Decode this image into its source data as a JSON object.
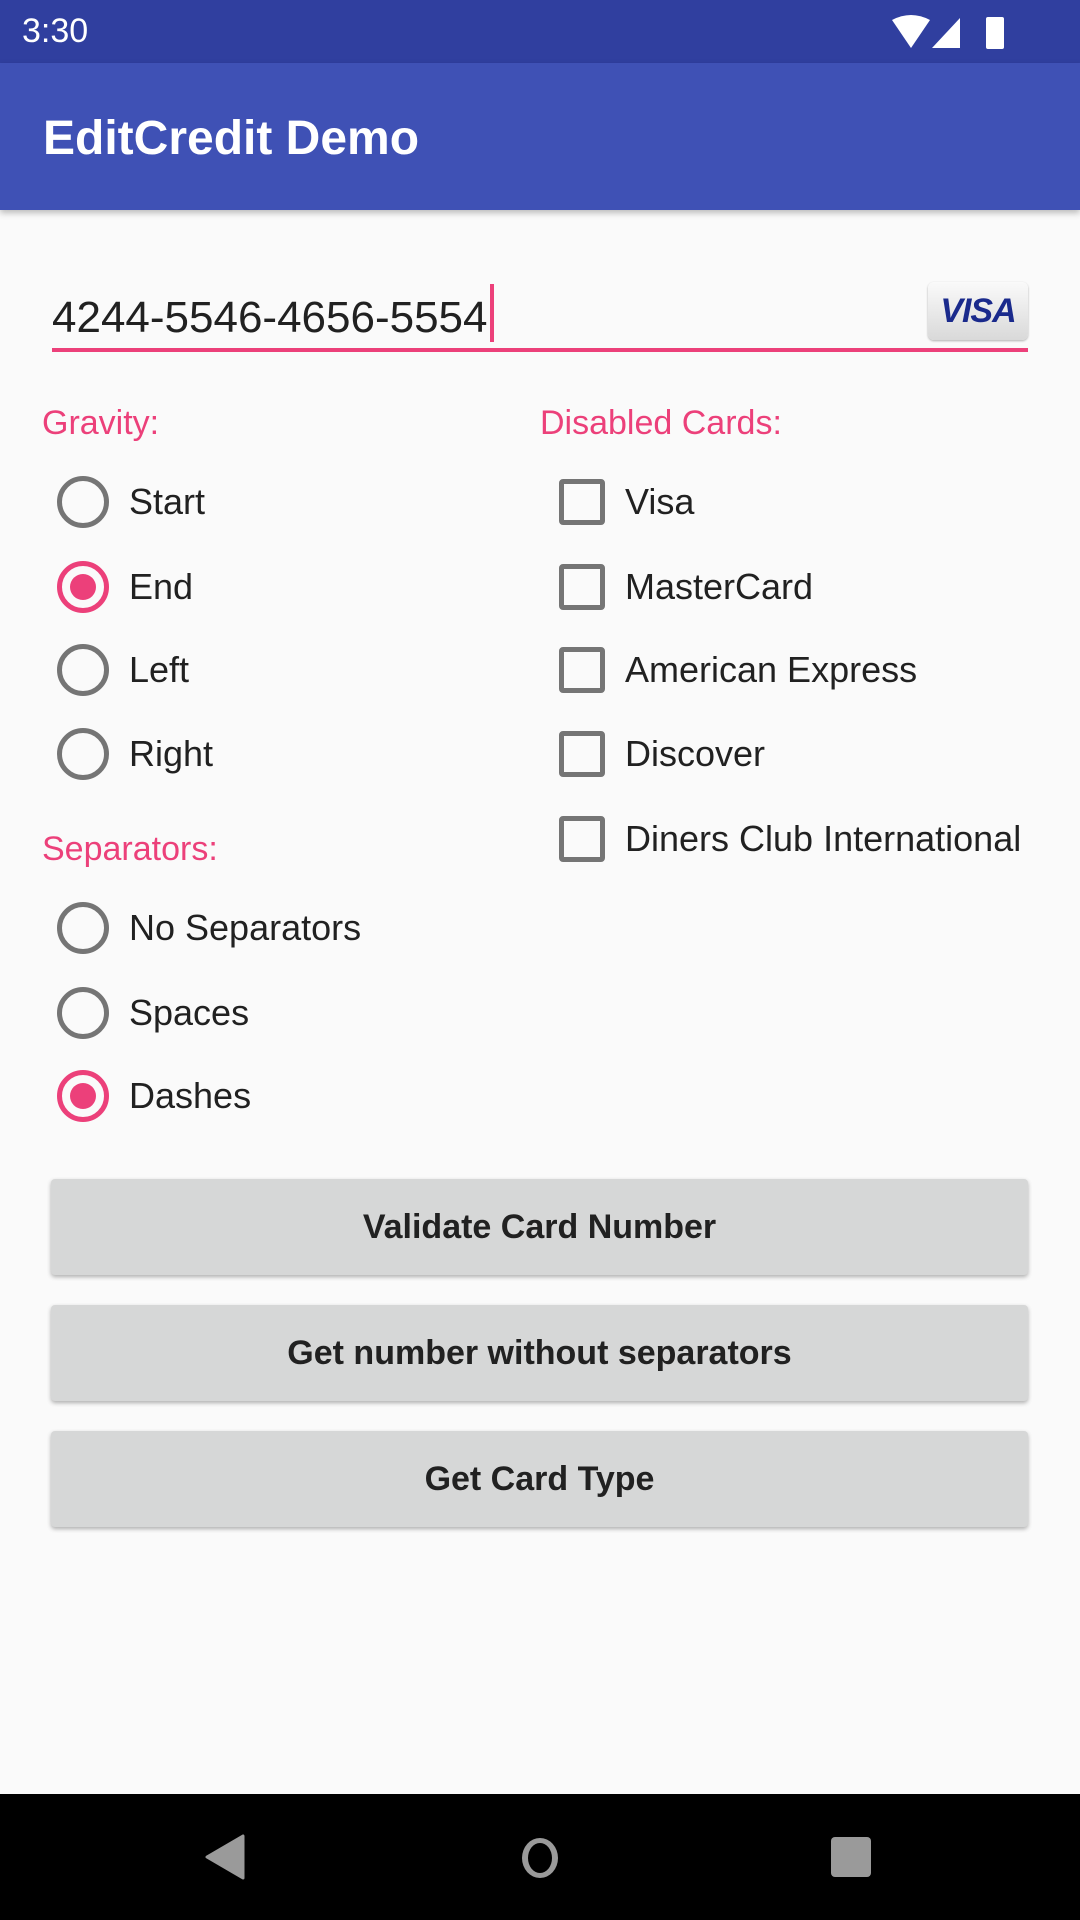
{
  "status_bar": {
    "time": "3:30",
    "icons": [
      "wifi-icon",
      "signal-icon",
      "battery-icon"
    ]
  },
  "app_bar": {
    "title": "EditCredit Demo"
  },
  "card_input": {
    "value": "4244-5546-4656-5554",
    "card_type_icon": "VISA"
  },
  "gravity": {
    "label": "Gravity:",
    "options": [
      {
        "label": "Start",
        "checked": false
      },
      {
        "label": "End",
        "checked": true
      },
      {
        "label": "Left",
        "checked": false
      },
      {
        "label": "Right",
        "checked": false
      }
    ]
  },
  "separators": {
    "label": "Separators:",
    "options": [
      {
        "label": "No Separators",
        "checked": false
      },
      {
        "label": "Spaces",
        "checked": false
      },
      {
        "label": "Dashes",
        "checked": true
      }
    ]
  },
  "disabled_cards": {
    "label": "Disabled Cards:",
    "options": [
      {
        "label": "Visa",
        "checked": false
      },
      {
        "label": "MasterCard",
        "checked": false
      },
      {
        "label": "American Express",
        "checked": false
      },
      {
        "label": "Discover",
        "checked": false
      },
      {
        "label": "Diners Club International",
        "checked": false
      }
    ]
  },
  "buttons": {
    "validate": "Validate Card Number",
    "without_separators": "Get number without separators",
    "card_type": "Get Card Type"
  },
  "colors": {
    "accent": "#ec407a",
    "primary": "#3f51b5",
    "primary_dark": "#303f9f"
  }
}
